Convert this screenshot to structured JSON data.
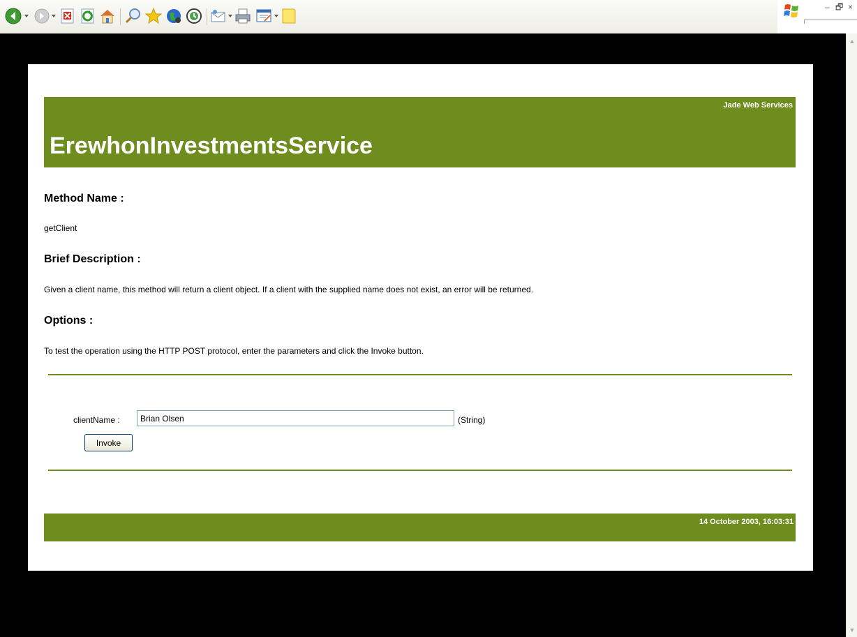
{
  "toolbar": {
    "buttons": [
      {
        "name": "back",
        "icon": "back-arrow-icon",
        "color": "#3d9a31"
      },
      {
        "name": "forward",
        "icon": "forward-arrow-icon",
        "color": "#b9b9b9"
      },
      {
        "name": "stop",
        "icon": "stop-icon",
        "color": "#d6271b"
      },
      {
        "name": "refresh",
        "icon": "refresh-icon",
        "color": "#2e9b2a"
      },
      {
        "name": "home",
        "icon": "home-icon"
      },
      {
        "name": "search",
        "icon": "search-icon"
      },
      {
        "name": "favorites",
        "icon": "star-icon",
        "color": "#f4c60f"
      },
      {
        "name": "media",
        "icon": "media-globe-icon"
      },
      {
        "name": "history",
        "icon": "history-icon"
      },
      {
        "name": "mail",
        "icon": "mail-icon"
      },
      {
        "name": "print",
        "icon": "print-icon"
      },
      {
        "name": "edit",
        "icon": "edit-icon"
      },
      {
        "name": "discuss",
        "icon": "note-icon"
      }
    ],
    "window_buttons": {
      "minimize": "–",
      "restore": "🗗",
      "close": "×"
    }
  },
  "page": {
    "brand": "Jade Web Services",
    "service_name": "ErewhonInvestmentsService",
    "method_heading": "Method Name :",
    "method_name": "getClient",
    "description_heading": "Brief Description :",
    "description": "Given a client name, this method will return a client object. If a client with the supplied name does not exist, an error will be returned.",
    "options_heading": "Options :",
    "options_text": "To test the operation using the HTTP POST protocol, enter the parameters and click the Invoke button.",
    "param": {
      "label": "clientName :",
      "value": "Brian Olsen",
      "type": "(String)"
    },
    "invoke_label": "Invoke",
    "timestamp": "14 October 2003, 16:03:31",
    "accent_color": "#6f8d1f"
  }
}
